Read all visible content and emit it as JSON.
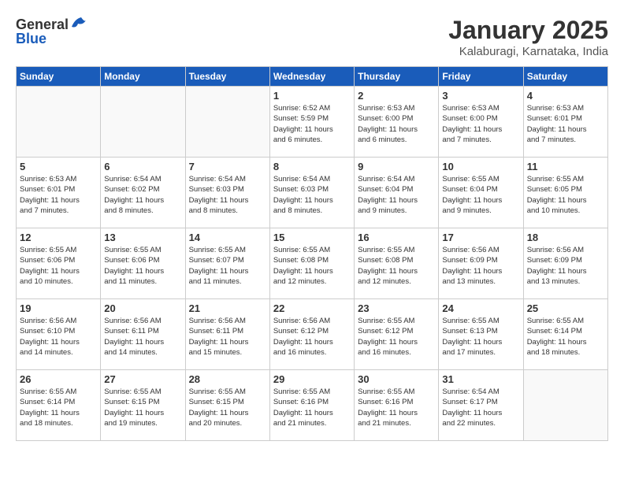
{
  "header": {
    "logo_general": "General",
    "logo_blue": "Blue",
    "month_title": "January 2025",
    "location": "Kalaburagi, Karnataka, India"
  },
  "days_of_week": [
    "Sunday",
    "Monday",
    "Tuesday",
    "Wednesday",
    "Thursday",
    "Friday",
    "Saturday"
  ],
  "weeks": [
    [
      {
        "day": "",
        "info": ""
      },
      {
        "day": "",
        "info": ""
      },
      {
        "day": "",
        "info": ""
      },
      {
        "day": "1",
        "info": "Sunrise: 6:52 AM\nSunset: 5:59 PM\nDaylight: 11 hours\nand 6 minutes."
      },
      {
        "day": "2",
        "info": "Sunrise: 6:53 AM\nSunset: 6:00 PM\nDaylight: 11 hours\nand 6 minutes."
      },
      {
        "day": "3",
        "info": "Sunrise: 6:53 AM\nSunset: 6:00 PM\nDaylight: 11 hours\nand 7 minutes."
      },
      {
        "day": "4",
        "info": "Sunrise: 6:53 AM\nSunset: 6:01 PM\nDaylight: 11 hours\nand 7 minutes."
      }
    ],
    [
      {
        "day": "5",
        "info": "Sunrise: 6:53 AM\nSunset: 6:01 PM\nDaylight: 11 hours\nand 7 minutes."
      },
      {
        "day": "6",
        "info": "Sunrise: 6:54 AM\nSunset: 6:02 PM\nDaylight: 11 hours\nand 8 minutes."
      },
      {
        "day": "7",
        "info": "Sunrise: 6:54 AM\nSunset: 6:03 PM\nDaylight: 11 hours\nand 8 minutes."
      },
      {
        "day": "8",
        "info": "Sunrise: 6:54 AM\nSunset: 6:03 PM\nDaylight: 11 hours\nand 8 minutes."
      },
      {
        "day": "9",
        "info": "Sunrise: 6:54 AM\nSunset: 6:04 PM\nDaylight: 11 hours\nand 9 minutes."
      },
      {
        "day": "10",
        "info": "Sunrise: 6:55 AM\nSunset: 6:04 PM\nDaylight: 11 hours\nand 9 minutes."
      },
      {
        "day": "11",
        "info": "Sunrise: 6:55 AM\nSunset: 6:05 PM\nDaylight: 11 hours\nand 10 minutes."
      }
    ],
    [
      {
        "day": "12",
        "info": "Sunrise: 6:55 AM\nSunset: 6:06 PM\nDaylight: 11 hours\nand 10 minutes."
      },
      {
        "day": "13",
        "info": "Sunrise: 6:55 AM\nSunset: 6:06 PM\nDaylight: 11 hours\nand 11 minutes."
      },
      {
        "day": "14",
        "info": "Sunrise: 6:55 AM\nSunset: 6:07 PM\nDaylight: 11 hours\nand 11 minutes."
      },
      {
        "day": "15",
        "info": "Sunrise: 6:55 AM\nSunset: 6:08 PM\nDaylight: 11 hours\nand 12 minutes."
      },
      {
        "day": "16",
        "info": "Sunrise: 6:55 AM\nSunset: 6:08 PM\nDaylight: 11 hours\nand 12 minutes."
      },
      {
        "day": "17",
        "info": "Sunrise: 6:56 AM\nSunset: 6:09 PM\nDaylight: 11 hours\nand 13 minutes."
      },
      {
        "day": "18",
        "info": "Sunrise: 6:56 AM\nSunset: 6:09 PM\nDaylight: 11 hours\nand 13 minutes."
      }
    ],
    [
      {
        "day": "19",
        "info": "Sunrise: 6:56 AM\nSunset: 6:10 PM\nDaylight: 11 hours\nand 14 minutes."
      },
      {
        "day": "20",
        "info": "Sunrise: 6:56 AM\nSunset: 6:11 PM\nDaylight: 11 hours\nand 14 minutes."
      },
      {
        "day": "21",
        "info": "Sunrise: 6:56 AM\nSunset: 6:11 PM\nDaylight: 11 hours\nand 15 minutes."
      },
      {
        "day": "22",
        "info": "Sunrise: 6:56 AM\nSunset: 6:12 PM\nDaylight: 11 hours\nand 16 minutes."
      },
      {
        "day": "23",
        "info": "Sunrise: 6:55 AM\nSunset: 6:12 PM\nDaylight: 11 hours\nand 16 minutes."
      },
      {
        "day": "24",
        "info": "Sunrise: 6:55 AM\nSunset: 6:13 PM\nDaylight: 11 hours\nand 17 minutes."
      },
      {
        "day": "25",
        "info": "Sunrise: 6:55 AM\nSunset: 6:14 PM\nDaylight: 11 hours\nand 18 minutes."
      }
    ],
    [
      {
        "day": "26",
        "info": "Sunrise: 6:55 AM\nSunset: 6:14 PM\nDaylight: 11 hours\nand 18 minutes."
      },
      {
        "day": "27",
        "info": "Sunrise: 6:55 AM\nSunset: 6:15 PM\nDaylight: 11 hours\nand 19 minutes."
      },
      {
        "day": "28",
        "info": "Sunrise: 6:55 AM\nSunset: 6:15 PM\nDaylight: 11 hours\nand 20 minutes."
      },
      {
        "day": "29",
        "info": "Sunrise: 6:55 AM\nSunset: 6:16 PM\nDaylight: 11 hours\nand 21 minutes."
      },
      {
        "day": "30",
        "info": "Sunrise: 6:55 AM\nSunset: 6:16 PM\nDaylight: 11 hours\nand 21 minutes."
      },
      {
        "day": "31",
        "info": "Sunrise: 6:54 AM\nSunset: 6:17 PM\nDaylight: 11 hours\nand 22 minutes."
      },
      {
        "day": "",
        "info": ""
      }
    ]
  ]
}
